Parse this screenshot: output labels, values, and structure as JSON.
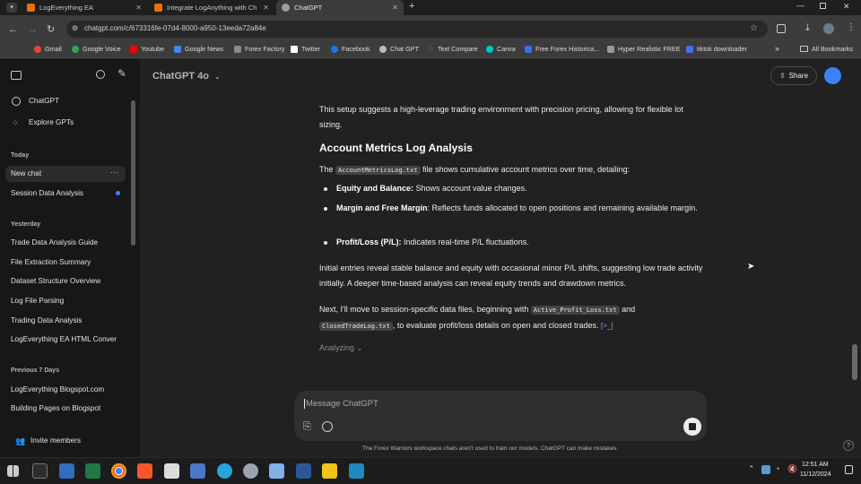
{
  "browser": {
    "tabs": [
      {
        "title": "LogEverything EA",
        "color": "#e8710a"
      },
      {
        "title": "Integrate LogAnything with Ch",
        "color": "#e8710a"
      },
      {
        "title": "ChatGPT",
        "color": "#9e9e9e"
      }
    ],
    "url": "chatgpt.com/c/673316fe-07d4-8000-a950-13eeda72a84e",
    "bookmarks": [
      {
        "label": "Gmail",
        "color": "#ea4335"
      },
      {
        "label": "Google Voice",
        "color": "#34a853"
      },
      {
        "label": "Youtube",
        "color": "#ff0000"
      },
      {
        "label": "Google News",
        "color": "#4285f4"
      },
      {
        "label": "Forex Factory",
        "color": "#888888"
      },
      {
        "label": "Twitter",
        "color": "#ffffff"
      },
      {
        "label": "Facebook",
        "color": "#1877f2"
      },
      {
        "label": "Chat GPT",
        "color": "#bbbbbb"
      },
      {
        "label": "Text Compare",
        "color": "#444444"
      },
      {
        "label": "Canva",
        "color": "#00c4cc"
      },
      {
        "label": "Free Forex Historica...",
        "color": "#3a6ee8"
      },
      {
        "label": "Hyper Realistic FREE",
        "color": "#999999"
      },
      {
        "label": "tiktok downloader",
        "color": "#4a6cf7"
      }
    ],
    "all_bookmarks": "All Bookmarks"
  },
  "sidebar": {
    "top_items": [
      "ChatGPT",
      "Explore GPTs"
    ],
    "sections": [
      {
        "label": "Today",
        "items": [
          "New chat",
          "Session Data Analysis"
        ]
      },
      {
        "label": "Yesterday",
        "items": [
          "Trade Data Analysis Guide",
          "File Extraction Summary",
          "Dataset Structure Overview",
          "Log File Parsing",
          "Trading Data Analysis",
          "LogEverything EA HTML Conver"
        ]
      },
      {
        "label": "Previous 7 Days",
        "items": [
          "LogEverything Blogspot.com",
          "Building Pages on Blogspot"
        ]
      }
    ],
    "invite": "Invite members"
  },
  "header": {
    "model": "ChatGPT 4o",
    "share": "Share"
  },
  "message": {
    "intro": "This setup suggests a high-leverage trading environment with precision pricing, allowing for flexible lot sizing.",
    "heading": "Account Metrics Log Analysis",
    "p1_a": "The",
    "p1_code": "AccountMetricsLog.txt",
    "p1_b": "file shows cumulative account metrics over time, detailing:",
    "bullets": [
      {
        "bold": "Equity and Balance:",
        "text": " Shows account value changes."
      },
      {
        "bold": "Margin and Free Margin",
        "text": ": Reflects funds allocated to open positions and remaining available margin."
      },
      {
        "bold": "Profit/Loss (P/L):",
        "text": " Indicates real-time P/L fluctuations."
      }
    ],
    "p2": "Initial entries reveal stable balance and equity with occasional minor P/L shifts, suggesting low trade activity initially. A deeper time-based analysis can reveal equity trends and drawdown metrics.",
    "p3_a": "Next, I'll move to session-specific data files, beginning with",
    "p3_code1": "Active_Profit_Loss.txt",
    "p3_b": "and",
    "p3_code2": "ClosedTradeLog.txt",
    "p3_c": ", to evaluate profit/loss details on open and closed trades.",
    "p3_link": "[>_]",
    "status": "Analyzing"
  },
  "composer": {
    "placeholder": "Message ChatGPT"
  },
  "footer": "The Forex Warriors workspace chats aren't used to train our models. ChatGPT can make mistakes.",
  "taskbar": {
    "time": "12:51 AM",
    "date": "11/12/2024"
  }
}
